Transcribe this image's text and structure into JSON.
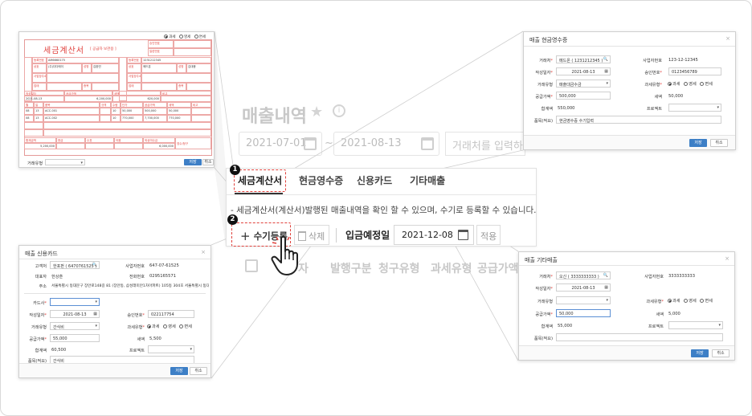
{
  "background": {
    "title": "매출내역",
    "date_from": "2021-07-01",
    "date_sep": "~",
    "date_to": "2021-08-13",
    "partner_placeholder": "거래처를 입력하세",
    "columns": [
      "자",
      "발행구분",
      "청구유형",
      "과세유형",
      "공급가액"
    ]
  },
  "central": {
    "tabs": [
      "세금계산서",
      "현금영수증",
      "신용카드",
      "기타매출"
    ],
    "active_tab": "세금계산서",
    "description": "- 세금계산서(계산서)발행된 매출내역을 확인 할 수 있으며, 수기로 등록할 수 있습니다.",
    "add_button": "수기등록",
    "add_icon": "+",
    "delete_button": "삭제",
    "deposit_label": "입금예정일",
    "deposit_date": "2021-12-08",
    "apply_button": "적용",
    "step1": "1",
    "step2": "2",
    "highlight_color": "#e0413c"
  },
  "cash_receipt": {
    "title": "매출 현금영수증",
    "fields": {
      "partner_label": "거래처",
      "partner_value": "메드온 ( 1231212345 )",
      "biz_no_label": "사업자번호",
      "biz_no_value": "123-12-12345",
      "write_date_label": "작성일자",
      "write_date_value": "2021-08-13",
      "approval_label": "승인번호",
      "approval_value": "0123456789",
      "trade_type_label": "거래유형",
      "trade_type_value": "매출대금수금",
      "tax_type_label": "과세유형",
      "tax_options": [
        "과세",
        "영세",
        "면세"
      ],
      "supply_label": "공급가액",
      "supply_value": "500,000",
      "tax_label": "세액",
      "tax_value": "50,000",
      "total_label": "합계액",
      "total_value": "550,000",
      "project_label": "프로젝트",
      "memo_label": "품목(적요)",
      "memo_value": "현금영수증 수기입력"
    },
    "save": "저장",
    "cancel": "취소"
  },
  "credit_card": {
    "title": "매출 신용카드",
    "fields": {
      "customer_label": "고객처",
      "customer_value": "한포펀 ( 6470761525 )",
      "biz_no_label": "사업자번호",
      "biz_no_value": "647-07-61525",
      "ceo_label": "대표자",
      "ceo_value": "한상훈",
      "phone_label": "전화번호",
      "phone_value": "0295165571",
      "addr_label": "주소",
      "addr_value": "서울특별시 동대문구 장안로148길 81 (장안동, 삼성래미안1차아파트) 105동 304호 서울특별시 동대문",
      "card_label": "카드사",
      "write_date_label": "작성일자",
      "write_date_value": "2021-08-13",
      "approval_label": "승인번호",
      "approval_value": "022117754",
      "trade_type_label": "거래유형",
      "trade_type_value": "간식비",
      "tax_type_label": "과세유형",
      "tax_options": [
        "과세",
        "영세",
        "면세"
      ],
      "supply_label": "공급가액",
      "supply_value": "55,000",
      "tax_label": "세액",
      "tax_value": "5,500",
      "total_label": "합계액",
      "total_value": "60,500",
      "project_label": "프로젝트",
      "memo_label": "품목(적요)",
      "memo_value": "간식비"
    },
    "save": "저장",
    "cancel": "취소"
  },
  "other_sales": {
    "title": "매출 기타매출",
    "fields": {
      "partner_label": "거래처",
      "partner_value": "오신 ( 3333333333 )",
      "biz_no_label": "사업자번호",
      "biz_no_value": "3333333333",
      "write_date_label": "작성일자",
      "write_date_value": "2021-08-13",
      "trade_type_label": "거래유형",
      "tax_type_label": "과세유형",
      "tax_options": [
        "과세",
        "영세",
        "면세"
      ],
      "supply_label": "공급가액",
      "supply_value": "50,000",
      "tax_label": "세액",
      "tax_value": "5,000",
      "total_label": "합계액",
      "total_value": "55,000",
      "project_label": "프로젝트",
      "memo_label": "품목(적요)"
    },
    "save": "저장",
    "cancel": "취소"
  },
  "invoice": {
    "title": "세금계산서",
    "subtitle": "[ 공급자 보관용 ]",
    "tax_options": [
      "과세",
      "영세",
      "면세"
    ],
    "labels": {
      "approval": "승인번호",
      "serial": "일련번호",
      "reg_no": "등록번호",
      "company": "상호",
      "name": "성명",
      "address": "사업장주소",
      "business": "업태",
      "item": "종목",
      "write_date": "작성일자",
      "supply": "공급가액",
      "tax": "세액",
      "remark": "비고",
      "month": "월",
      "day": "일",
      "product": "품목",
      "spec": "규격",
      "qty": "수량",
      "unit": "단가",
      "total": "합계금액",
      "cash": "현금",
      "check": "수표",
      "note": "어음",
      "credit": "외상미수금",
      "receipt": "영수",
      "claim": "청구",
      "trade_type": "거래유형"
    },
    "supplier_reg": "AM6660175",
    "receiver_reg": "1231212345",
    "supplier_company": "(주)다다메이",
    "receiver_company": "메드온",
    "supplier_name": "김완민",
    "receiver_name": "김대응",
    "date": "2021-08-13",
    "row_supply": "6,200,000",
    "row_tax": "620,000",
    "rows": [
      {
        "m": "08",
        "d": "13",
        "item": "ACC-001",
        "qty": "10",
        "price": "50,000",
        "supply": "500,000",
        "tax": "50,000"
      },
      {
        "m": "08",
        "d": "13",
        "item": "ACC-002",
        "qty": "10",
        "price": "770,000",
        "supply": "7,700,000",
        "tax": "770,000"
      }
    ],
    "total_value": "5,200,000",
    "amount_value": "6,000,000",
    "save": "저장",
    "cancel": "취소"
  }
}
